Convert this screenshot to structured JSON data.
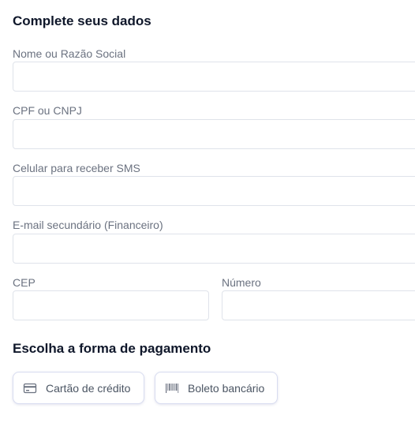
{
  "customer_section": {
    "title": "Complete seus dados",
    "fields": {
      "name": {
        "label": "Nome ou Razão Social",
        "value": "",
        "placeholder": ""
      },
      "document": {
        "label": "CPF ou CNPJ",
        "value": "",
        "placeholder": ""
      },
      "phone": {
        "label": "Celular para receber SMS",
        "value": "",
        "placeholder": ""
      },
      "secondary_email": {
        "label": "E-mail secundário (Financeiro)",
        "value": "",
        "placeholder": ""
      },
      "cep": {
        "label": "CEP",
        "value": "",
        "placeholder": ""
      },
      "number": {
        "label": "Número",
        "value": "",
        "placeholder": ""
      }
    }
  },
  "payment_section": {
    "title": "Escolha a forma de pagamento",
    "options": [
      {
        "label": "Cartão de crédito",
        "icon": "credit-card-icon"
      },
      {
        "label": "Boleto bancário",
        "icon": "barcode-icon"
      }
    ]
  },
  "colors": {
    "title_text": "#0f172a",
    "label_text": "#6b7280",
    "input_border": "#dfe3ea",
    "button_border": "#d8dcf0"
  }
}
